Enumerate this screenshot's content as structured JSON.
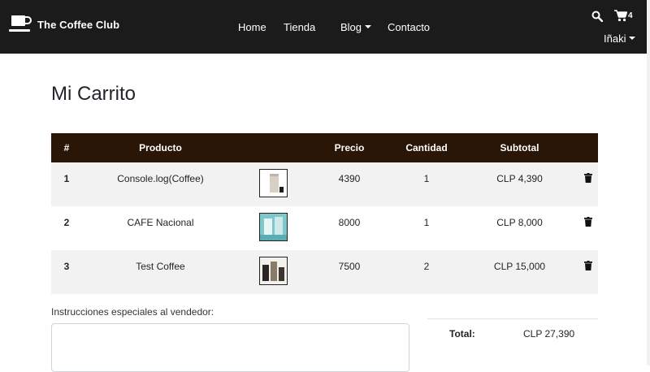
{
  "navbar": {
    "brand": "The Coffee Club",
    "links": {
      "home": "Home",
      "tienda": "Tienda",
      "blog": "Blog",
      "contacto": "Contacto"
    },
    "cart_count": "4",
    "user": "Iñaki",
    "icons": {
      "brand": "coffee-cup-icon",
      "search": "search-icon",
      "cart": "cart-icon"
    }
  },
  "page": {
    "title": "Mi Carrito"
  },
  "table": {
    "headers": {
      "num": "#",
      "product": "Producto",
      "price": "Precio",
      "qty": "Cantidad",
      "subtotal": "Subtotal"
    },
    "rows": [
      {
        "num": "1",
        "product": "Console.log(Coffee)",
        "price": "4390",
        "qty": "1",
        "subtotal": "CLP 4,390"
      },
      {
        "num": "2",
        "product": "CAFE Nacional",
        "price": "8000",
        "qty": "1",
        "subtotal": "CLP 8,000"
      },
      {
        "num": "3",
        "product": "Test Coffee",
        "price": "7500",
        "qty": "2",
        "subtotal": "CLP 15,000"
      }
    ]
  },
  "instructions": {
    "label": "Instrucciones especiales al vendedor:",
    "value": ""
  },
  "totals": {
    "label": "Total:",
    "value": "CLP 27,390"
  },
  "colors": {
    "navbar_bg": "#1b1b1b",
    "table_header_bg": "#2a1606",
    "row_stripe": "#f2f2f2"
  }
}
